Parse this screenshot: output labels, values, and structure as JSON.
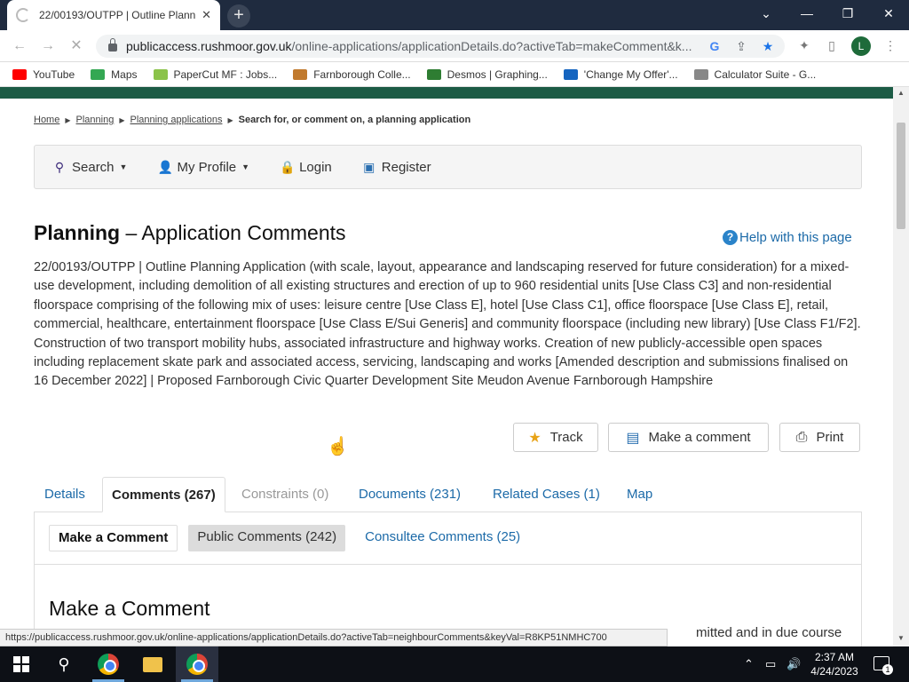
{
  "browser": {
    "tab_title": "22/00193/OUTPP | Outline Plann",
    "tab_close": "✕",
    "new_tab": "+",
    "url_domain": "publicaccess.rushmoor.gov.uk",
    "url_rest": "/online-applications/applicationDetails.do?activeTab=makeComment&k...",
    "profile_initial": "L",
    "bookmarks": [
      {
        "label": "YouTube",
        "color": "#ff0000"
      },
      {
        "label": "Maps",
        "color": "#34a853"
      },
      {
        "label": "PaperCut MF : Jobs...",
        "color": "#8bc34a"
      },
      {
        "label": "Farnborough Colle...",
        "color": "#c17a2e"
      },
      {
        "label": "Desmos | Graphing...",
        "color": "#2e7d32"
      },
      {
        "label": "'Change My Offer'...",
        "color": "#1565c0"
      },
      {
        "label": "Calculator Suite - G...",
        "color": "#888888"
      }
    ],
    "status_url": "https://publicaccess.rushmoor.gov.uk/online-applications/applicationDetails.do?activeTab=neighbourComments&keyVal=R8KP51NMHC700"
  },
  "breadcrumb": {
    "items": [
      "Home",
      "Planning",
      "Planning applications"
    ],
    "current": "Search for, or comment on, a planning application"
  },
  "nav": {
    "search": "Search",
    "profile": "My Profile",
    "login": "Login",
    "register": "Register"
  },
  "page": {
    "title_bold": "Planning",
    "title_rest": " – Application Comments",
    "help": "Help with this page",
    "description": "22/00193/OUTPP | Outline Planning Application (with scale, layout, appearance and landscaping reserved for future consideration) for a mixed-use development, including demolition of all existing structures and erection of up to 960 residential units [Use Class C3] and non-residential floorspace comprising of the following mix of uses: leisure centre [Use Class E], hotel [Use Class C1], office floorspace [Use Class E], retail, commercial, healthcare, entertainment floorspace [Use Class E/Sui Generis] and community floorspace (including new library) [Use Class F1/F2]. Construction of two transport mobility hubs, associated infrastructure and highway works. Creation of new publicly-accessible open spaces including replacement skate park and associated access, servicing, landscaping and works [Amended description and submissions finalised on 16 December 2022] | Proposed Farnborough Civic Quarter Development Site Meudon Avenue Farnborough Hampshire"
  },
  "actions": {
    "track": "Track",
    "make_comment": "Make a comment",
    "print": "Print"
  },
  "tabs": {
    "details": "Details",
    "comments": "Comments (267)",
    "constraints": "Constraints (0)",
    "documents": "Documents (231)",
    "related": "Related Cases (1)",
    "map": "Map"
  },
  "subtabs": {
    "make": "Make a Comment",
    "public": "Public Comments (242)",
    "consultee": "Consultee Comments (25)"
  },
  "panel": {
    "heading": "Make a Comment",
    "trailing_text": "mitted and in due course"
  },
  "taskbar": {
    "time": "2:37 AM",
    "date": "4/24/2023",
    "notifications": "1"
  },
  "colors": {
    "brand_green": "#1c5b45",
    "link_blue": "#1c6aa8"
  }
}
